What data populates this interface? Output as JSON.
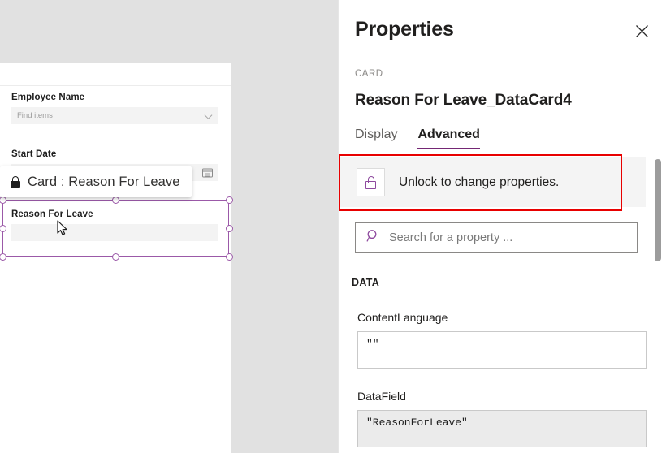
{
  "canvas": {
    "fields": [
      {
        "label": "Employee Name",
        "placeholder": "Find items",
        "control": "combobox",
        "icon": "chevron-down-icon"
      },
      {
        "label": "Start Date",
        "placeholder": "",
        "control": "datepicker",
        "icon": "calendar-icon"
      },
      {
        "label": "Reason For Leave",
        "placeholder": "",
        "control": "textinput",
        "icon": ""
      }
    ],
    "selection_tooltip": {
      "text": "Card : Reason For Leave",
      "icon": "lock-filled-icon"
    },
    "selection_color": "#9b59a8"
  },
  "panel": {
    "title": "Properties",
    "close_icon": "close-icon",
    "kicker": "CARD",
    "card_name": "Reason For Leave_DataCard4",
    "tabs": [
      {
        "label": "Display",
        "active": false
      },
      {
        "label": "Advanced",
        "active": true
      }
    ],
    "accent_color": "#742774",
    "highlight_color": "#e80000",
    "unlock_banner": {
      "text": "Unlock to change properties.",
      "icon": "lock-outline-icon"
    },
    "search": {
      "placeholder": "Search for a property ...",
      "value": "",
      "icon": "search-icon"
    },
    "sections": [
      {
        "heading": "DATA",
        "properties": [
          {
            "label": "ContentLanguage",
            "value": "\"\"",
            "readonly": false
          },
          {
            "label": "DataField",
            "value": "\"ReasonForLeave\"",
            "readonly": true
          }
        ]
      }
    ]
  }
}
